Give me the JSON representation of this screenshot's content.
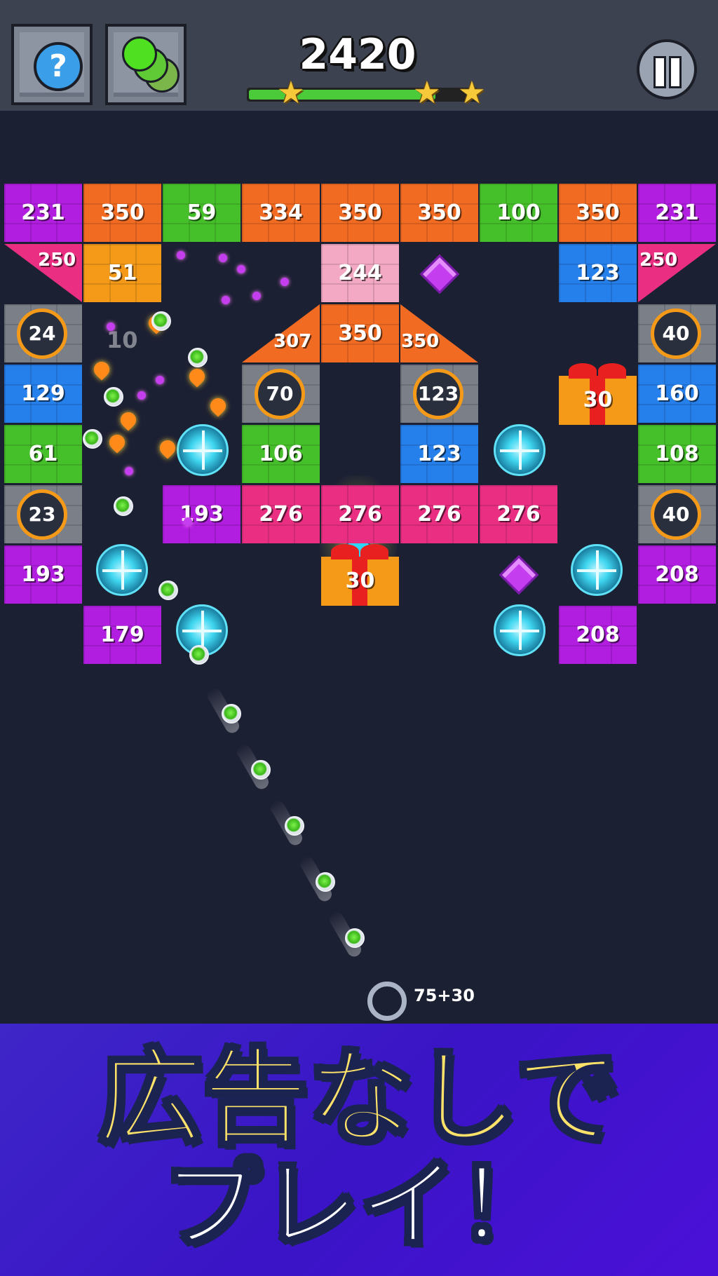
{
  "top_bar": {
    "help_symbol": "?",
    "score": "2420",
    "progress_fraction": 0.82,
    "stars_earned": 3,
    "pause_icon": "pause-icon",
    "balls_icon": "green-balls-icon"
  },
  "bricks": [
    {
      "value": "231",
      "color": "#b21ee0"
    },
    {
      "value": "350",
      "color": "#f26b22"
    },
    {
      "value": "59",
      "color": "#45c02a"
    },
    {
      "value": "334",
      "color": "#f26b22"
    },
    {
      "value": "350",
      "color": "#f26b22"
    },
    {
      "value": "350",
      "color": "#f26b22"
    },
    {
      "value": "100",
      "color": "#45c02a"
    },
    {
      "value": "350",
      "color": "#f26b22"
    },
    {
      "value": "231",
      "color": "#b21ee0"
    },
    {
      "value": "51",
      "color": "#f59a18"
    },
    {
      "value": "244",
      "color": "#f3a9c3"
    },
    {
      "value": "123",
      "color": "#2580ec"
    },
    {
      "value": "350",
      "color": "#f26b22"
    },
    {
      "value": "129",
      "color": "#2580ec"
    },
    {
      "value": "160",
      "color": "#2580ec"
    },
    {
      "value": "61",
      "color": "#45c02a"
    },
    {
      "value": "106",
      "color": "#45c02a"
    },
    {
      "value": "123",
      "color": "#2580ec"
    },
    {
      "value": "108",
      "color": "#45c02a"
    },
    {
      "value": "193",
      "color": "#b21ee0"
    },
    {
      "value": "276",
      "color": "#ea2f83"
    },
    {
      "value": "276",
      "color": "#ea2f83"
    },
    {
      "value": "276",
      "color": "#ea2f83"
    },
    {
      "value": "276",
      "color": "#ea2f83"
    },
    {
      "value": "193",
      "color": "#b21ee0"
    },
    {
      "value": "208",
      "color": "#b21ee0"
    },
    {
      "value": "179",
      "color": "#b21ee0"
    },
    {
      "value": "208",
      "color": "#b21ee0"
    }
  ],
  "triangles": [
    {
      "value": "250",
      "color": "#ea2f83"
    },
    {
      "value": "250",
      "color": "#ea2f83"
    },
    {
      "value": "307",
      "color": "#f26b22"
    },
    {
      "value": "350",
      "color": "#f26b22"
    }
  ],
  "bombs": [
    {
      "value": "24"
    },
    {
      "value": "40"
    },
    {
      "value": "70"
    },
    {
      "value": "123"
    },
    {
      "value": "23"
    },
    {
      "value": "40"
    }
  ],
  "gifts": [
    {
      "value": "30"
    },
    {
      "value": "30"
    }
  ],
  "floating_text": "10",
  "ball_count": "75+30",
  "banner": {
    "line1": "広告なしで",
    "line2": "プレイ！"
  }
}
